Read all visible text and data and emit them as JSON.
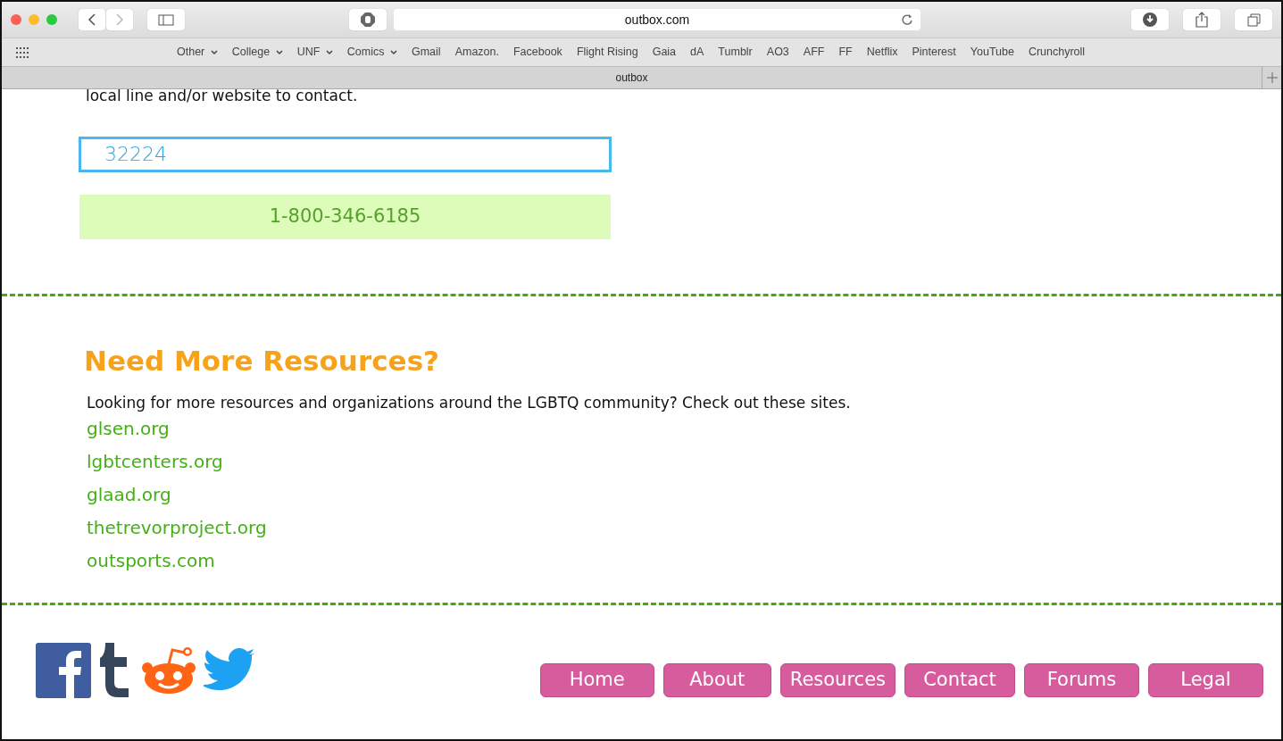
{
  "browser": {
    "url": "outbox.com",
    "tab_title": "outbox",
    "bookmarks": [
      {
        "label": "Other",
        "has_menu": true
      },
      {
        "label": "College",
        "has_menu": true
      },
      {
        "label": "UNF",
        "has_menu": true
      },
      {
        "label": "Comics",
        "has_menu": true
      },
      {
        "label": "Gmail",
        "has_menu": false
      },
      {
        "label": "Amazon.",
        "has_menu": false
      },
      {
        "label": "Facebook",
        "has_menu": false
      },
      {
        "label": "Flight Rising",
        "has_menu": false
      },
      {
        "label": "Gaia",
        "has_menu": false
      },
      {
        "label": "dA",
        "has_menu": false
      },
      {
        "label": "Tumblr",
        "has_menu": false
      },
      {
        "label": "AO3",
        "has_menu": false
      },
      {
        "label": "AFF",
        "has_menu": false
      },
      {
        "label": "FF",
        "has_menu": false
      },
      {
        "label": "Netflix",
        "has_menu": false
      },
      {
        "label": "Pinterest",
        "has_menu": false
      },
      {
        "label": "YouTube",
        "has_menu": false
      },
      {
        "label": "Crunchyroll",
        "has_menu": false
      }
    ]
  },
  "hotline": {
    "intro": "local line and/or website to contact.",
    "zip_value": "32224",
    "result": "1-800-346-6185"
  },
  "resources": {
    "heading": "Need More Resources?",
    "text": "Looking for more resources and organizations around the LGBTQ community? Check out these sites.",
    "links": [
      "glsen.org",
      "lgbtcenters.org",
      "glaad.org",
      "thetrevorproject.org",
      "outsports.com"
    ]
  },
  "footer": {
    "nav": [
      "Home",
      "About",
      "Resources",
      "Contact",
      "Forums",
      "Legal"
    ]
  }
}
